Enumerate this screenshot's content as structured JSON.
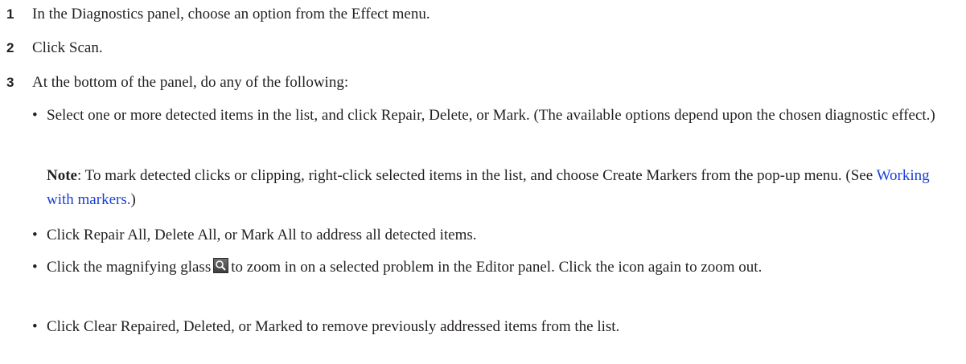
{
  "steps": [
    {
      "number": "1",
      "text": "In the Diagnostics panel, choose an option from the Effect menu."
    },
    {
      "number": "2",
      "text": "Click Scan."
    },
    {
      "number": "3",
      "text": "At the bottom of the panel, do any of the following:"
    }
  ],
  "bullets": {
    "marker": "•",
    "item1": "Select one or more detected items in the list, and click Repair, Delete, or Mark. (The available options depend upon the chosen diagnostic effect.)",
    "item2": "Click Repair All, Delete All, or Mark All to address all detected items.",
    "item3_before": "Click the magnifying glass",
    "item3_after": "to zoom in on a selected problem in the Editor panel. Click the icon again to zoom out.",
    "item4": "Click Clear Repaired, Deleted, or Marked to remove previously addressed items from the list."
  },
  "note": {
    "label": "Note",
    "text_before": ":  To mark detected clicks or clipping, right-click selected items in the list, and choose Create Markers from the pop-up menu. (See ",
    "link_text": "Working with markers.",
    "text_after": ")"
  },
  "colors": {
    "link": "#1a3fd6",
    "text": "#231f20"
  }
}
